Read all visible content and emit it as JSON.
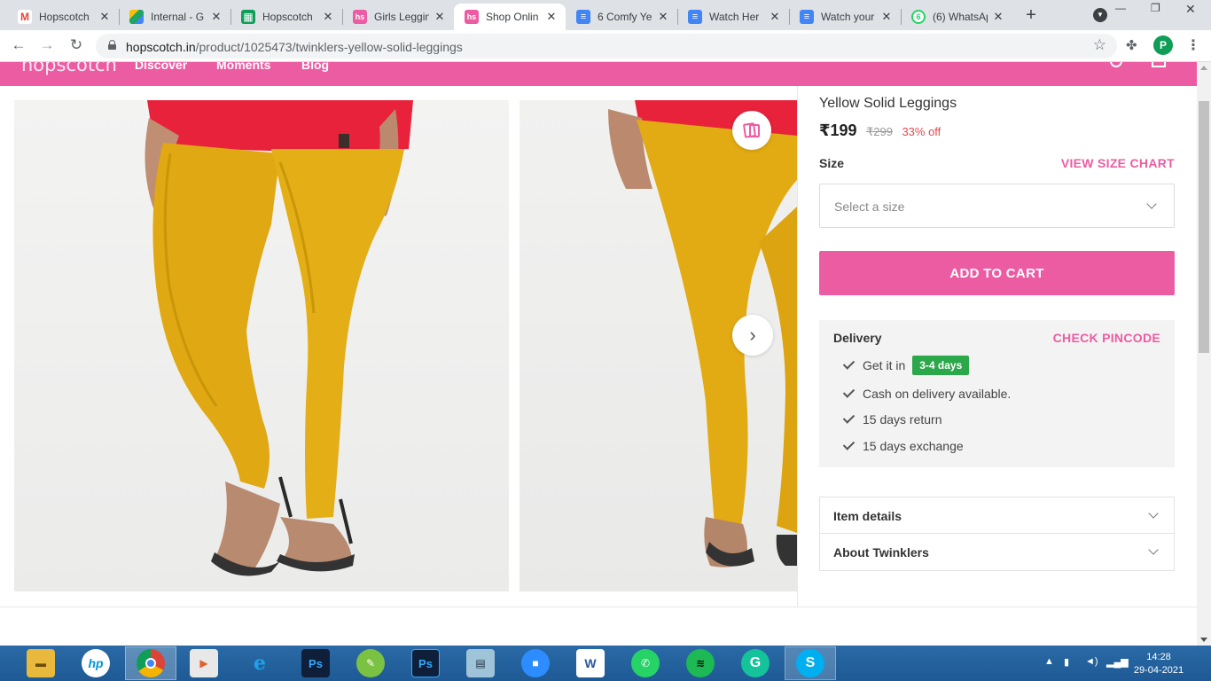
{
  "browser": {
    "tabs": [
      {
        "label": "Hopscotch",
        "favicon": "gmail-icon",
        "color": "#ea4335"
      },
      {
        "label": "Internal - G",
        "favicon": "google-drive-icon",
        "color": "#1fa463"
      },
      {
        "label": "Hopscotch",
        "favicon": "google-sheets-icon",
        "color": "#0f9d58"
      },
      {
        "label": "Girls Leggin",
        "favicon": "hopscotch-icon",
        "color": "#ec5ca3"
      },
      {
        "label": "Shop Onlin",
        "favicon": "hopscotch-icon",
        "color": "#ec5ca3"
      },
      {
        "label": "6 Comfy Ye",
        "favicon": "google-docs-icon",
        "color": "#4285f4"
      },
      {
        "label": "Watch Her",
        "favicon": "google-docs-icon",
        "color": "#4285f4"
      },
      {
        "label": "Watch your",
        "favicon": "google-docs-icon",
        "color": "#4285f4"
      },
      {
        "label": "(6) WhatsAp",
        "favicon": "whatsapp-icon",
        "color": "#25d366"
      }
    ],
    "active_tab_index": 4,
    "url_domain": "hopscotch.in",
    "url_path": "/product/1025473/twinklers-yellow-solid-leggings",
    "profile_initial": "P"
  },
  "site": {
    "logo": "hopscotch",
    "nav": [
      "Discover",
      "Moments",
      "Blog"
    ],
    "brand_color": "#ec5ca3"
  },
  "product": {
    "title": "Yellow Solid Leggings",
    "price": "₹199",
    "mrp": "₹299",
    "discount": "33% off",
    "size_label": "Size",
    "size_chart_link": "VIEW SIZE CHART",
    "size_placeholder": "Select a size",
    "add_to_cart": "ADD TO CART"
  },
  "delivery": {
    "title": "Delivery",
    "check_pincode": "CHECK PINCODE",
    "get_it_in": "Get it in",
    "days_badge": "3-4 days",
    "items": [
      "Cash on delivery available.",
      "15 days return",
      "15 days exchange"
    ]
  },
  "accordion": [
    "Item details",
    "About Twinklers"
  ],
  "taskbar": {
    "apps": [
      "file-explorer-icon",
      "hp-icon",
      "chrome-icon",
      "media-player-icon",
      "internet-explorer-icon",
      "photoshop-icon",
      "green-app-icon",
      "photoshop-icon",
      "notepad-icon",
      "zoom-icon",
      "word-icon",
      "whatsapp-icon",
      "spotify-icon",
      "grammarly-icon",
      "skype-icon"
    ],
    "time": "14:28",
    "date": "29-04-2021"
  }
}
